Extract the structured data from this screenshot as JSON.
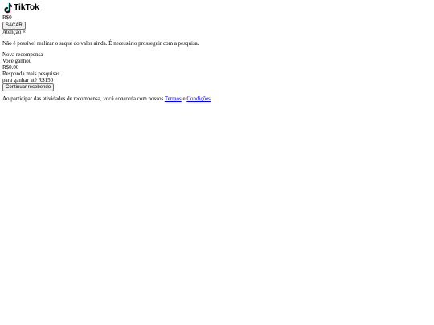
{
  "brand": {
    "name": "TikTok",
    "logo_icon": "tiktok-note-icon"
  },
  "balance": {
    "amount": "R$0",
    "withdraw_label": "SACAR"
  },
  "alert": {
    "title": "Atenção",
    "close_symbol": "×",
    "message": "Não é possível realizar o saque do valor ainda. É necessário prosseguir com a pesquisa."
  },
  "reward": {
    "heading": "Nova recompensa",
    "earned_label": "Você ganhou",
    "earned_amount": "R$0.00",
    "prompt_line1": "Responda mais pesquisas",
    "prompt_line2": "para ganhar até R$150",
    "continue_label": "Continuar recebendo"
  },
  "footer": {
    "text_before": "Ao participar das atividades de recompensa, você concorda com nossos",
    "terms_link": "Termos",
    "conjunction": "e",
    "conditions_link": "Condições",
    "period": "."
  },
  "colors": {
    "text": "#000000",
    "link": "#0000ee",
    "background": "#ffffff",
    "logo_cyan": "#25f4ee",
    "logo_red": "#fe2c55"
  }
}
